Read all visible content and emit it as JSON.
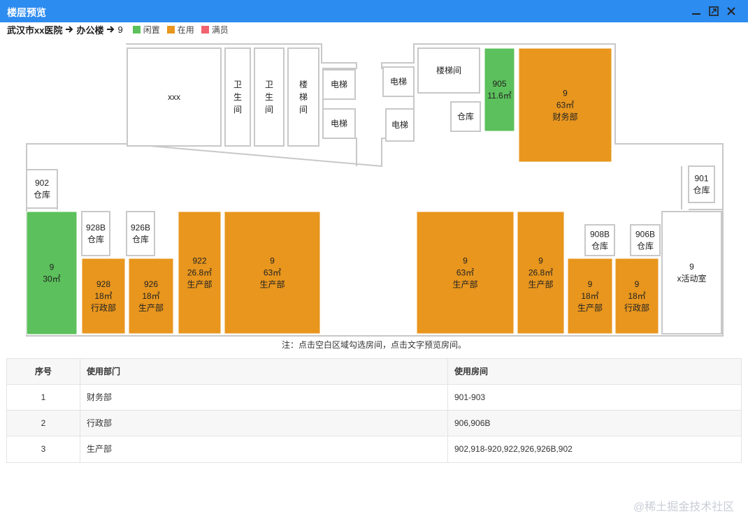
{
  "window": {
    "title": "楼层预览"
  },
  "breadcrumb": {
    "hospital": "武汉市xx医院",
    "building": "办公楼",
    "floor": "9"
  },
  "legend": [
    {
      "label": "闲置",
      "color": "#5cc05c"
    },
    {
      "label": "在用",
      "color": "#e8961e"
    },
    {
      "label": "满员",
      "color": "#f0646e"
    }
  ],
  "plan": {
    "rooms": [
      {
        "id": "xxx",
        "lines": [
          "xxx"
        ],
        "status": "outline"
      },
      {
        "id": "wc1",
        "lines": [
          "卫",
          "生",
          "间"
        ],
        "status": "outline"
      },
      {
        "id": "wc2",
        "lines": [
          "卫",
          "生",
          "间"
        ],
        "status": "outline"
      },
      {
        "id": "stairs-left",
        "lines": [
          "楼",
          "梯",
          "间"
        ],
        "status": "outline"
      },
      {
        "id": "elev-1",
        "lines": [
          "电梯"
        ],
        "status": "outline"
      },
      {
        "id": "elev-2",
        "lines": [
          "电梯"
        ],
        "status": "outline"
      },
      {
        "id": "elev-3",
        "lines": [
          "电梯"
        ],
        "status": "outline"
      },
      {
        "id": "elev-4",
        "lines": [
          "电梯"
        ],
        "status": "outline"
      },
      {
        "id": "stairs-right",
        "lines": [
          "楼梯间"
        ],
        "status": "outline"
      },
      {
        "id": "storage-top",
        "lines": [
          "仓库"
        ],
        "status": "outline"
      },
      {
        "id": "905",
        "lines": [
          "905",
          "11.6㎡"
        ],
        "status": "idle"
      },
      {
        "id": "903",
        "lines": [
          "9",
          "63㎡",
          "财务部"
        ],
        "status": "inuse"
      },
      {
        "id": "902",
        "lines": [
          "902",
          "仓库"
        ],
        "status": "outline"
      },
      {
        "id": "901",
        "lines": [
          "901",
          "仓库"
        ],
        "status": "outline"
      },
      {
        "id": "930",
        "lines": [
          "9",
          "30㎡"
        ],
        "status": "idle"
      },
      {
        "id": "928B",
        "lines": [
          "928B",
          "仓库"
        ],
        "status": "outline"
      },
      {
        "id": "926B",
        "lines": [
          "926B",
          "仓库"
        ],
        "status": "outline"
      },
      {
        "id": "928",
        "lines": [
          "928",
          "18㎡",
          "行政部"
        ],
        "status": "inuse"
      },
      {
        "id": "926",
        "lines": [
          "926",
          "18㎡",
          "生产部"
        ],
        "status": "inuse"
      },
      {
        "id": "922",
        "lines": [
          "922",
          "26.8㎡",
          "生产部"
        ],
        "status": "inuse"
      },
      {
        "id": "920",
        "lines": [
          "9",
          "63㎡",
          "生产部"
        ],
        "status": "inuse"
      },
      {
        "id": "918",
        "lines": [
          "9",
          "63㎡",
          "生产部"
        ],
        "status": "inuse"
      },
      {
        "id": "912",
        "lines": [
          "9",
          "26.8㎡",
          "生产部"
        ],
        "status": "inuse"
      },
      {
        "id": "908B",
        "lines": [
          "908B",
          "仓库"
        ],
        "status": "outline"
      },
      {
        "id": "906B",
        "lines": [
          "906B",
          "仓库"
        ],
        "status": "outline"
      },
      {
        "id": "908",
        "lines": [
          "9",
          "18㎡",
          "生产部"
        ],
        "status": "inuse"
      },
      {
        "id": "906",
        "lines": [
          "9",
          "18㎡",
          "行政部"
        ],
        "status": "inuse"
      },
      {
        "id": "activity",
        "lines": [
          "9",
          "x活动室"
        ],
        "status": "outline"
      }
    ]
  },
  "note": "注：点击空白区域勾选房间，点击文字预览房间。",
  "table": {
    "headers": [
      "序号",
      "使用部门",
      "使用房间"
    ],
    "rows": [
      [
        "1",
        "财务部",
        "901-903"
      ],
      [
        "2",
        "行政部",
        "906,906B"
      ],
      [
        "3",
        "生产部",
        "902,918-920,922,926,926B,902"
      ]
    ]
  },
  "watermark": "@稀土掘金技术社区"
}
